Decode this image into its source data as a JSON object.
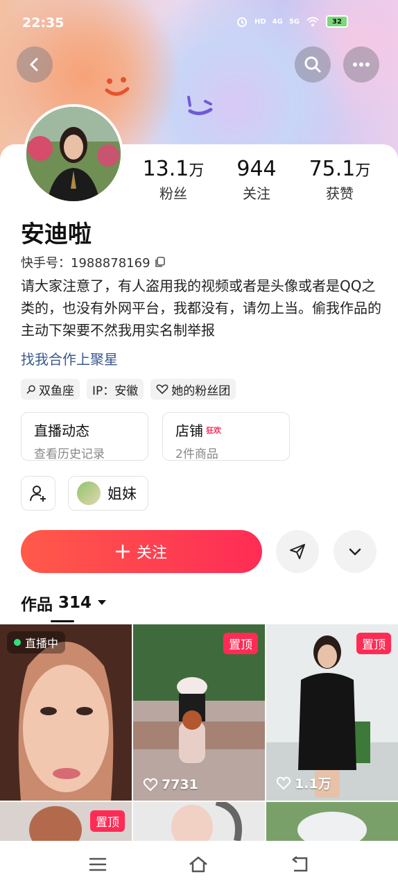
{
  "status_bar": {
    "time": "22:35",
    "battery": "32",
    "net1": "4G",
    "net2": "5G",
    "hd": "HD"
  },
  "profile": {
    "name": "安迪啦",
    "kuaishou_id": "快手号：1988878169",
    "stats": [
      {
        "num": "13.1",
        "unit": "万",
        "label": "粉丝"
      },
      {
        "num": "944",
        "unit": "",
        "label": "关注"
      },
      {
        "num": "75.1",
        "unit": "万",
        "label": "获赞"
      }
    ],
    "bio": "请大家注意了，有人盗用我的视频或者是头像或者是QQ之类的，也没有外网平台，我都没有，请勿上当。偷我作品的主动下架要不然我用实名制举报",
    "coop_link": "找我合作上聚星",
    "tags": [
      "双鱼座",
      "IP：安徽",
      "她的粉丝团"
    ]
  },
  "boxes": [
    {
      "title": "直播动态",
      "sub": "查看历史记录"
    },
    {
      "title": "店铺",
      "badge": "狂欢",
      "sub": "2件商品"
    }
  ],
  "sister_label": "姐妹",
  "follow_label": "关注",
  "works": {
    "label": "作品",
    "count": "314"
  },
  "tiles": [
    {
      "badge": "直播中"
    },
    {
      "pin": "置顶",
      "likes": "7731"
    },
    {
      "pin": "置顶",
      "likes": "1.1万"
    },
    {
      "pin": "置顶"
    }
  ],
  "colors": {
    "accent": "#fe2c55",
    "link": "#3a5a8c"
  }
}
